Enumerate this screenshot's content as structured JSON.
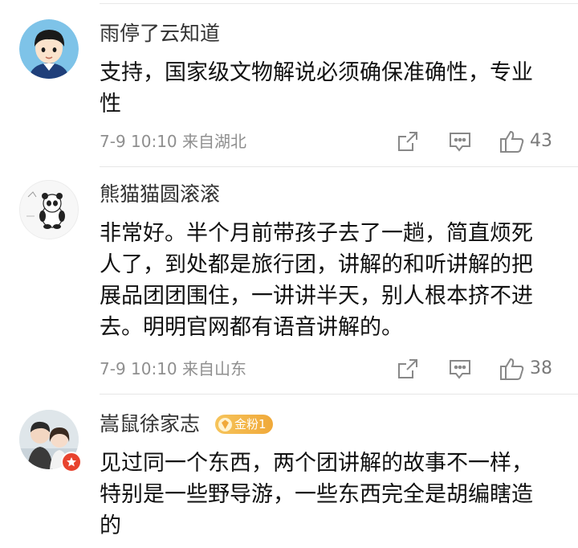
{
  "comments": [
    {
      "username": "雨停了云知道",
      "content": "支持，国家级文物解说必须确保准确性，专业性",
      "date": "7-9 10:10",
      "location": "来自湖北",
      "likes": "43",
      "icons": [
        "share-icon",
        "reply-icon",
        "thumbs-up-icon"
      ]
    },
    {
      "username": "熊猫猫圆滚滚",
      "content": "非常好。半个月前带孩子去了一趟，简直烦死人了，到处都是旅行团，讲解的和听讲解的把展品团团围住，一讲讲半天，别人根本挤不进去。明明官网都有语音讲解的。",
      "date": "7-9 10:10",
      "location": "来自山东",
      "likes": "38",
      "icons": [
        "share-icon",
        "reply-icon",
        "thumbs-up-icon"
      ]
    },
    {
      "username": "嵩鼠徐家志",
      "badge": "金粉1",
      "content": "见过同一个东西，两个团讲解的故事不一样，特别是一些野导游，一些东西完全是胡编瞎造的"
    }
  ],
  "colors": {
    "text_primary": "#111111",
    "username": "#333333",
    "meta": "#8f8f8f",
    "icon": "#888888",
    "badge": "#f0a93a"
  }
}
